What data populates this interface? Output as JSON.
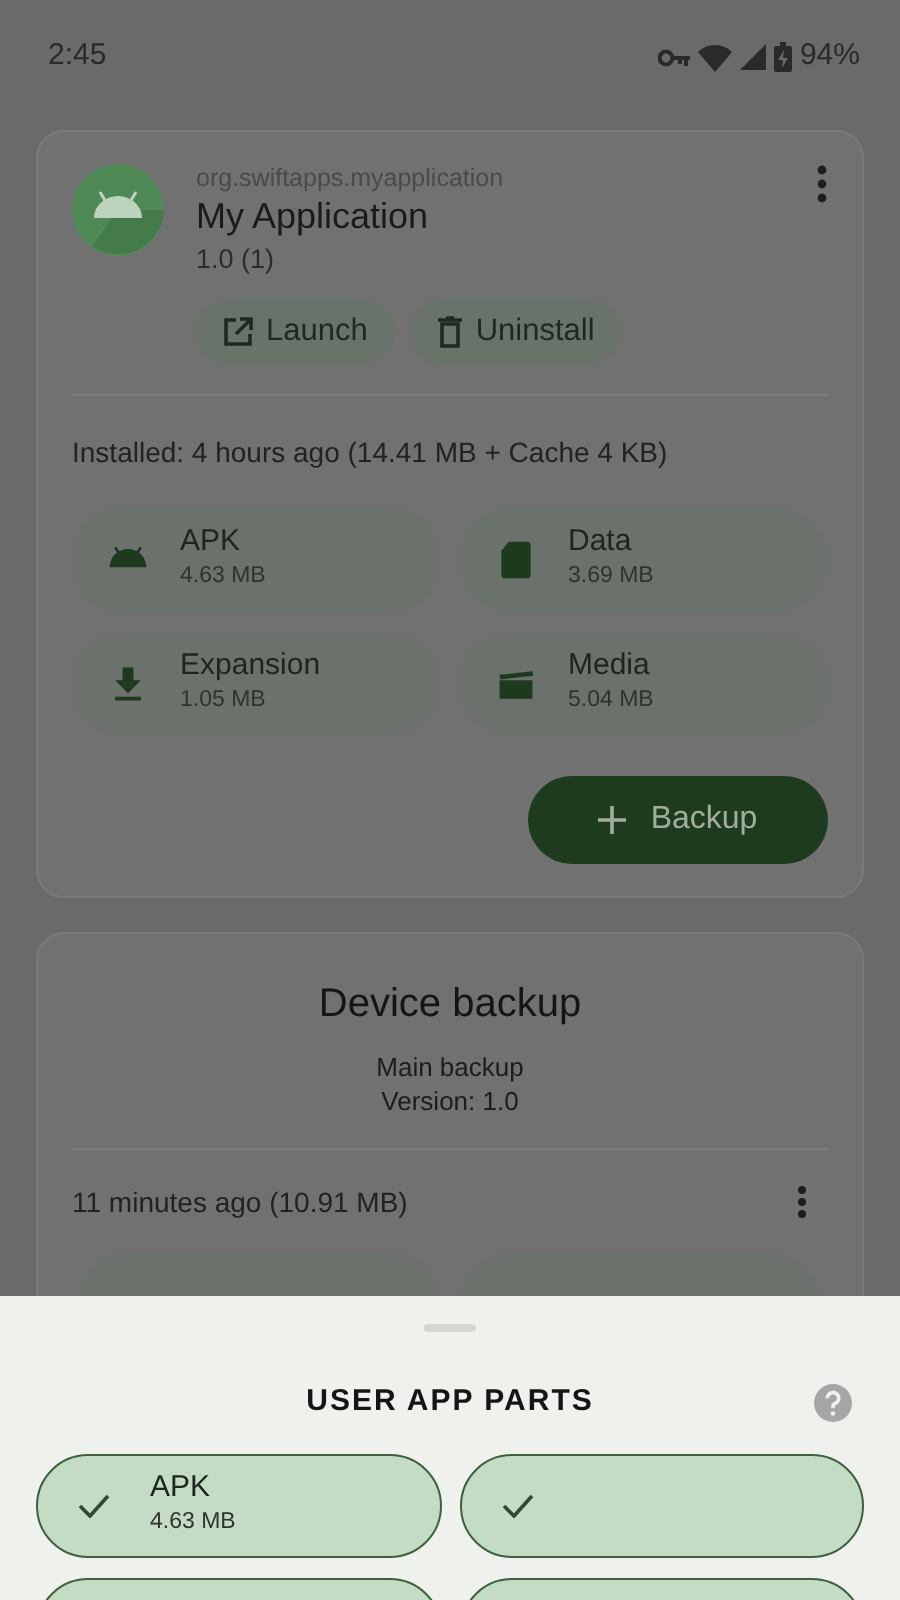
{
  "status_bar": {
    "time": "2:45",
    "battery": "94%"
  },
  "app_card": {
    "package": "org.swiftapps.myapplication",
    "title": "My Application",
    "version": "1.0 (1)",
    "actions": [
      {
        "kind": "launch",
        "label": "Launch"
      },
      {
        "kind": "uninstall",
        "label": "Uninstall"
      }
    ],
    "installed": "Installed: 4 hours ago (14.41 MB + Cache 4 KB)",
    "parts": [
      {
        "kind": "apk",
        "label": "APK",
        "size": "4.63 MB"
      },
      {
        "kind": "data",
        "label": "Data",
        "size": "3.69 MB"
      },
      {
        "kind": "expansion",
        "label": "Expansion",
        "size": "1.05 MB"
      },
      {
        "kind": "media",
        "label": "Media",
        "size": "5.04 MB"
      }
    ],
    "backup_button": "Backup"
  },
  "device_backup": {
    "title": "Device backup",
    "name": "Main backup",
    "version": "Version: 1.0",
    "time": "11 minutes ago (10.91 MB)",
    "parts": [
      {
        "kind": "chip"
      },
      {
        "kind": "chip"
      }
    ]
  },
  "sheet": {
    "title": "USER APP PARTS",
    "parts": [
      {
        "label": "APK",
        "size": "4.63 MB",
        "selected": true,
        "kind": "full"
      },
      {
        "selected": true,
        "kind": "full"
      },
      {
        "selected": true,
        "kind": "cut"
      },
      {
        "selected": true,
        "kind": "cut"
      }
    ]
  }
}
